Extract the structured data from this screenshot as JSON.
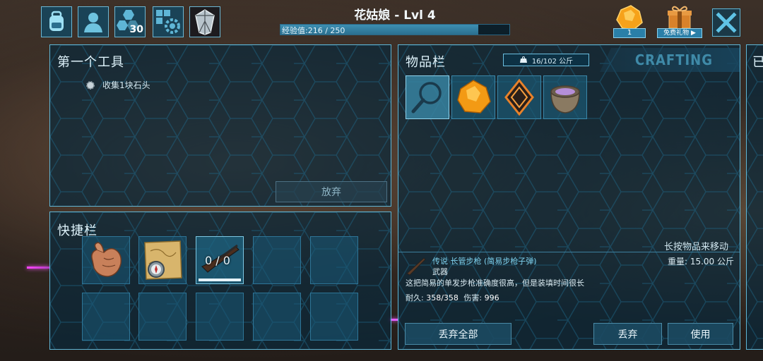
{
  "header": {
    "player_title": "花姑娘 - Lvl 4",
    "xp_text": "经验值:216 / 250",
    "xp_fraction": 0.864,
    "level_badge": "30",
    "gem_count": "1",
    "free_gift_label": "免费礼物 ▶"
  },
  "objective_panel": {
    "title": "第一个工具",
    "task": "收集1块石头",
    "give_up_label": "放弃"
  },
  "hotbar_panel": {
    "title": "快捷栏",
    "slots": [
      {
        "icon": "hand-icon"
      },
      {
        "icon": "map-compass-icon"
      },
      {
        "icon": "rifle-icon",
        "overlay": "0 / 0",
        "selected": true
      },
      {
        "icon": ""
      },
      {
        "icon": ""
      },
      {
        "icon": ""
      },
      {
        "icon": ""
      },
      {
        "icon": ""
      },
      {
        "icon": ""
      },
      {
        "icon": ""
      }
    ]
  },
  "inventory_panel": {
    "title": "物品栏",
    "weight": "16/102 公斤",
    "crafting_tab": "CRAFTING",
    "items": [
      {
        "icon": "search-icon"
      },
      {
        "icon": "amber-icon"
      },
      {
        "icon": "implant-icon"
      },
      {
        "icon": "mortar-pestle-icon"
      }
    ],
    "hint": "长按物品来移动",
    "selected_item": {
      "name": "传说 长管步枪 (简易步枪子弹)",
      "category": "武器",
      "weight": "重量: 15.00 公斤",
      "description": "这把简易的单发步枪准确度很高，但是装填时间很长",
      "durability_label": "耐久:",
      "durability": "358/358",
      "damage_label": "伤害:",
      "damage": "996"
    },
    "drop_all_label": "丢弃全部",
    "drop_label": "丢弃",
    "use_label": "使用"
  },
  "side_panel": {
    "title_fragment": "已"
  },
  "colors": {
    "panel_border": "#5fb6d6",
    "legendary_text": "#7fd3f0",
    "xp_fill": "#3d8fb2"
  }
}
